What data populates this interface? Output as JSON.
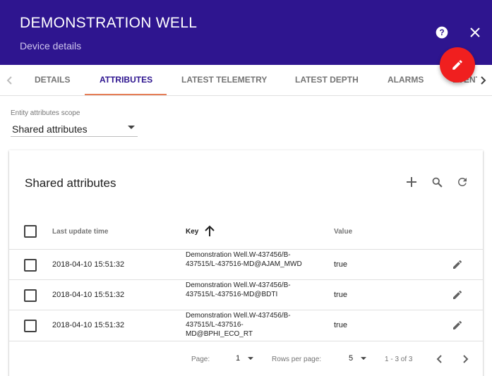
{
  "header": {
    "title": "DEMONSTRATION WELL",
    "subtitle": "Device details",
    "help_icon": "help-circle-icon",
    "close_icon": "close-icon",
    "background": "#2e158f"
  },
  "fab": {
    "icon": "pencil-icon",
    "color": "#f01f1f"
  },
  "tabs": [
    {
      "label": "DETAILS",
      "active": false
    },
    {
      "label": "ATTRIBUTES",
      "active": true
    },
    {
      "label": "LATEST TELEMETRY",
      "active": false
    },
    {
      "label": "LATEST DEPTH",
      "active": false
    },
    {
      "label": "ALARMS",
      "active": false
    },
    {
      "label": "EVENTS",
      "active": false
    }
  ],
  "scope": {
    "label": "Entity attributes scope",
    "value": "Shared attributes"
  },
  "table": {
    "title": "Shared attributes",
    "columns": {
      "time": "Last update time",
      "key": "Key",
      "value": "Value"
    },
    "rows": [
      {
        "time": "2018-04-10 15:51:32",
        "key": "Demonstration Well.W-437456/B-437515/L-437516-MD@AJAM_MWD",
        "value": "true"
      },
      {
        "time": "2018-04-10 15:51:32",
        "key": "Demonstration Well.W-437456/B-437515/L-437516-MD@BDTI",
        "value": "true"
      },
      {
        "time": "2018-04-10 15:51:32",
        "key": "Demonstration Well.W-437456/B-437515/L-437516-MD@BPHI_ECO_RT",
        "value": "true"
      }
    ],
    "pagination": {
      "page_label": "Page:",
      "page_value": "1",
      "rows_label": "Rows per page:",
      "rows_value": "5",
      "range": "1 - 3 of 3"
    }
  },
  "colors": {
    "accent": "#e57d56",
    "primary": "#2e158f"
  }
}
